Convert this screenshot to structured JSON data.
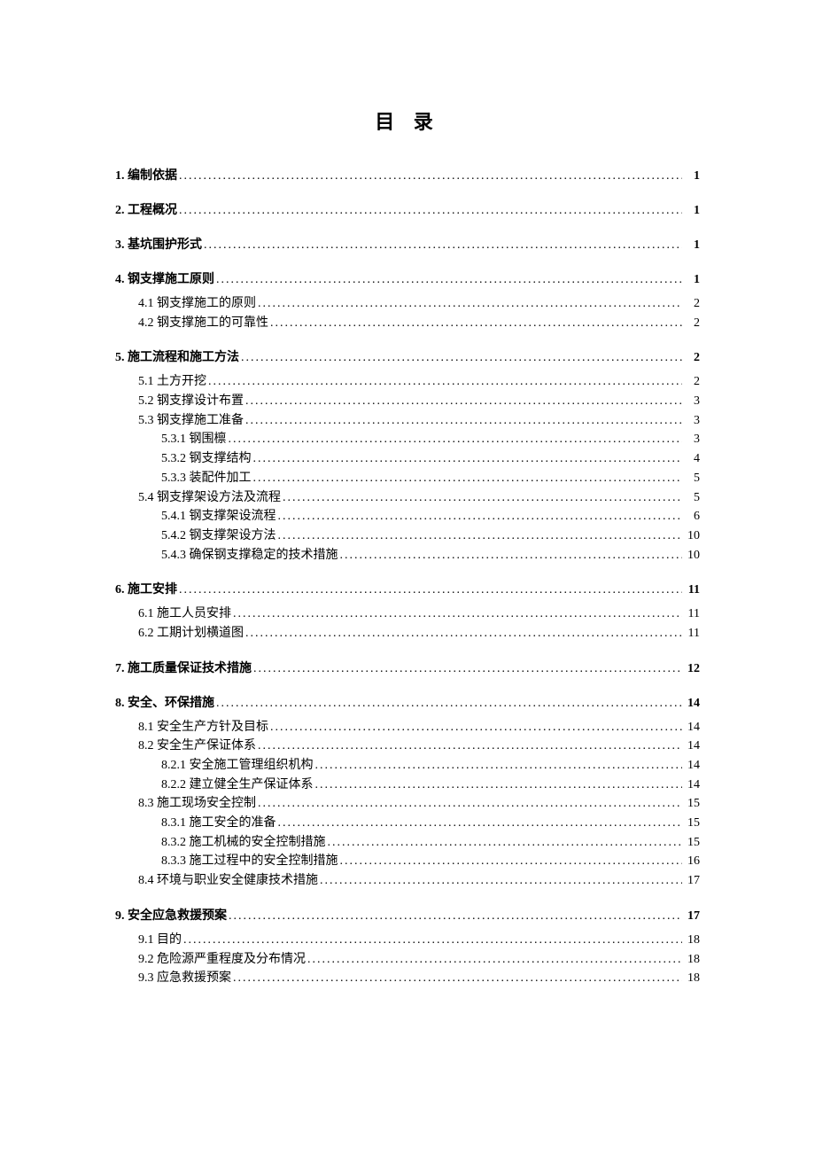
{
  "title": "目 录",
  "toc": [
    {
      "level": 1,
      "label": "1. 编制依据",
      "page": "1"
    },
    {
      "level": 1,
      "label": "2. 工程概况",
      "page": "1"
    },
    {
      "level": 1,
      "label": "3. 基坑围护形式",
      "page": "1"
    },
    {
      "level": 1,
      "label": "4. 钢支撑施工原则",
      "page": "1"
    },
    {
      "level": 2,
      "label": "4.1 钢支撑施工的原则",
      "page": "2"
    },
    {
      "level": 2,
      "label": "4.2 钢支撑施工的可靠性",
      "page": "2"
    },
    {
      "level": 1,
      "label": "5. 施工流程和施工方法",
      "page": "2"
    },
    {
      "level": 2,
      "label": "5.1 土方开挖",
      "page": "2"
    },
    {
      "level": 2,
      "label": "5.2 钢支撑设计布置",
      "page": "3"
    },
    {
      "level": 2,
      "label": "5.3 钢支撑施工准备",
      "page": "3"
    },
    {
      "level": 3,
      "label": "5.3.1 钢围檩",
      "page": "3"
    },
    {
      "level": 3,
      "label": "5.3.2 钢支撑结构",
      "page": "4"
    },
    {
      "level": 3,
      "label": "5.3.3 装配件加工",
      "page": "5"
    },
    {
      "level": 2,
      "label": "5.4 钢支撑架设方法及流程",
      "page": "5"
    },
    {
      "level": 3,
      "label": "5.4.1 钢支撑架设流程",
      "page": "6"
    },
    {
      "level": 3,
      "label": "5.4.2 钢支撑架设方法",
      "page": "10"
    },
    {
      "level": 3,
      "label": "5.4.3 确保钢支撑稳定的技术措施",
      "page": "10"
    },
    {
      "level": 1,
      "label": "6. 施工安排",
      "page": "11"
    },
    {
      "level": 2,
      "label": "6.1 施工人员安排",
      "page": "11"
    },
    {
      "level": 2,
      "label": "6.2 工期计划横道图",
      "page": "11"
    },
    {
      "level": 1,
      "label": "7. 施工质量保证技术措施",
      "page": "12"
    },
    {
      "level": 1,
      "label": "8. 安全、环保措施",
      "page": "14"
    },
    {
      "level": 2,
      "label": "8.1 安全生产方针及目标",
      "page": "14"
    },
    {
      "level": 2,
      "label": "8.2 安全生产保证体系",
      "page": "14"
    },
    {
      "level": 3,
      "label": "8.2.1 安全施工管理组织机构",
      "page": "14"
    },
    {
      "level": 3,
      "label": "8.2.2 建立健全生产保证体系",
      "page": "14"
    },
    {
      "level": 2,
      "label": "8.3 施工现场安全控制",
      "page": "15"
    },
    {
      "level": 3,
      "label": "8.3.1 施工安全的准备",
      "page": "15"
    },
    {
      "level": 3,
      "label": "8.3.2 施工机械的安全控制措施",
      "page": "15"
    },
    {
      "level": 3,
      "label": "8.3.3 施工过程中的安全控制措施",
      "page": "16"
    },
    {
      "level": 2,
      "label": "8.4 环境与职业安全健康技术措施",
      "page": "17"
    },
    {
      "level": 1,
      "label": "9. 安全应急救援预案",
      "page": "17"
    },
    {
      "level": 2,
      "label": "9.1 目的",
      "page": "18"
    },
    {
      "level": 2,
      "label": "9.2 危险源严重程度及分布情况",
      "page": "18"
    },
    {
      "level": 2,
      "label": "9.3 应急救援预案",
      "page": "18"
    }
  ]
}
